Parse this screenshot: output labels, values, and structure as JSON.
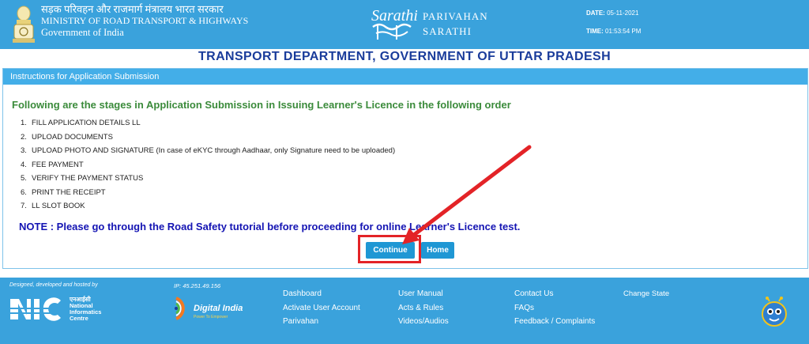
{
  "header": {
    "ministry_hindi": "सड़क परिवहन और राजमार्ग मंत्रालय भारत सरकार",
    "ministry_en": "MINISTRY OF ROAD TRANSPORT & HIGHWAYS",
    "gov": "Government of India",
    "logo_text": "Sarathi",
    "brand_line1": "PARIVAHAN",
    "brand_line2": "SARATHI",
    "date_label": "DATE:",
    "date_value": "05-11-2021",
    "time_label": "TIME:",
    "time_value": "01:53:54 PM"
  },
  "dept_title": "TRANSPORT DEPARTMENT, GOVERNMENT OF UTTAR PRADESH",
  "panel": {
    "heading": "Instructions for Application Submission",
    "stages_heading": "Following are the stages in Application Submission in Issuing Learner's Licence in the following order",
    "stages": [
      {
        "num": "1.",
        "text": "FILL APPLICATION DETAILS LL"
      },
      {
        "num": "2.",
        "text": "UPLOAD DOCUMENTS"
      },
      {
        "num": "3.",
        "text": "UPLOAD PHOTO AND SIGNATURE (In case of eKYC through Aadhaar, only Signature need to be uploaded)"
      },
      {
        "num": "4.",
        "text": "FEE PAYMENT"
      },
      {
        "num": "5.",
        "text": "VERIFY THE PAYMENT STATUS"
      },
      {
        "num": "6.",
        "text": "PRINT THE RECEIPT"
      },
      {
        "num": "7.",
        "text": "LL SLOT BOOK"
      }
    ],
    "note": "NOTE : Please go through the Road Safety tutorial before proceeding for online Learner's Licence test.",
    "continue_label": "Continue",
    "home_label": "Home"
  },
  "footer": {
    "designed_by": "Designed, developed and hosted by",
    "ip": "IP: 45.251.49.156",
    "nic_hindi": "एनआईसी",
    "nic_line1": "National",
    "nic_line2": "Informatics",
    "nic_line3": "Centre",
    "di_text": "Digital India",
    "di_sub": "Power To Empower",
    "col1": [
      "Dashboard",
      "Activate User Account",
      "Parivahan"
    ],
    "col2": [
      "User Manual",
      "Acts & Rules",
      "Videos/Audios"
    ],
    "col3": [
      "Contact Us",
      "FAQs",
      "Feedback / Complaints"
    ],
    "change_state": "Change State"
  },
  "colors": {
    "header_bg": "#3aa2dc",
    "title_blue": "#1a3c9b",
    "stage_green": "#3b8b3b",
    "note_blue": "#1414b3",
    "button_blue": "#1f97d4",
    "annotation_red": "#e32327"
  },
  "icons": [
    "national-emblem-icon",
    "sarathi-logo-icon",
    "nic-logo-icon",
    "digital-india-logo-icon",
    "mascot-icon",
    "red-arrow-annotation"
  ]
}
